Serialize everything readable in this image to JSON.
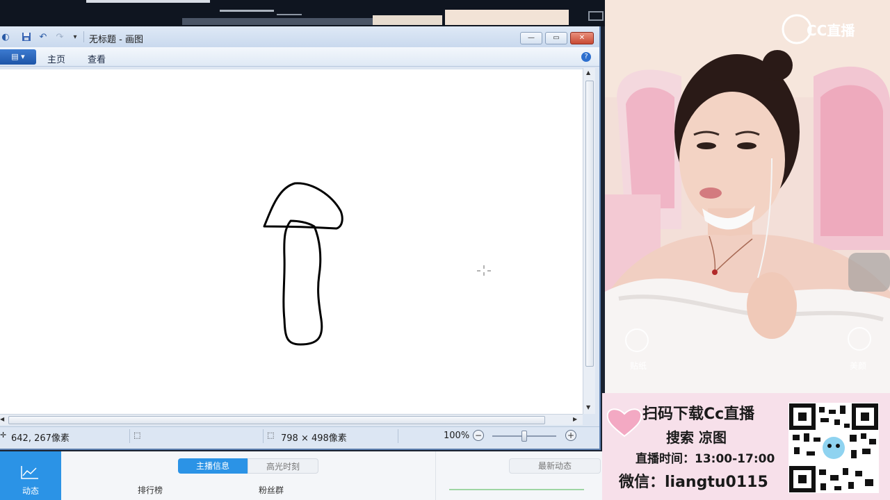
{
  "paint": {
    "title": "无标题 - 画图",
    "window_buttons": [
      "—",
      "▭",
      "✕"
    ],
    "ribbon_tabs": [
      "主页",
      "查看"
    ],
    "file_button": "▤ ▾",
    "help": "?",
    "status": {
      "cursor_pos": "642, 267像素",
      "canvas_size": "798 × 498像素",
      "zoom": "100%",
      "zoom_minus": "−",
      "zoom_plus": "+"
    },
    "drawing_stroke_color": "#000000"
  },
  "app": {
    "dynamic_tile": "动态",
    "tabs": [
      "主播信息",
      "高光时刻"
    ],
    "rank": "排行榜",
    "fans": "粉丝群",
    "newest": "最新动态"
  },
  "stream": {
    "logo": "CC直播",
    "sticker": "贴纸",
    "beauty": "美颜",
    "ad_line1": "扫码下载Cc直播",
    "ad_line2": "搜索 凉图",
    "ad_line3": "直播时间：13:00-17:00",
    "ad_line4": "微信：liangtu0115"
  },
  "colors": {
    "accent": "#2b93e6",
    "paint_titlebar": "#c9d9ee",
    "close_button": "#c84a34"
  }
}
